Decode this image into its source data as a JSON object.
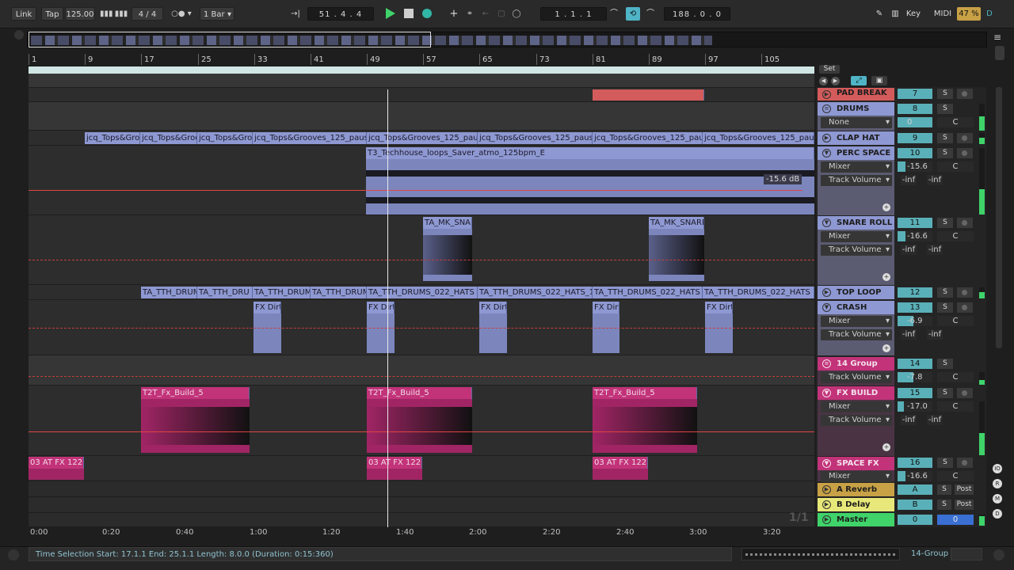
{
  "toolbar": {
    "link": "Link",
    "tap": "Tap",
    "tempo": "125.00",
    "signature": "4 / 4",
    "quantize": "1 Bar",
    "position": "51 . 4 . 4",
    "loop_start": "1 . 1 . 1",
    "loop_length": "188 . 0 . 0",
    "key": "Key",
    "midi": "MIDI",
    "cpu": "47 %",
    "disk": "D"
  },
  "ruler": {
    "bars": [
      "1",
      "9",
      "17",
      "25",
      "33",
      "41",
      "49",
      "57",
      "65",
      "73",
      "81",
      "89",
      "97",
      "105"
    ],
    "set_label": "Set"
  },
  "times": [
    "0:00",
    "0:20",
    "0:40",
    "1:00",
    "1:20",
    "1:40",
    "2:00",
    "2:20",
    "2:40",
    "3:00",
    "3:20"
  ],
  "page_counter": "1/1",
  "clips": {
    "tops": [
      "jcq_Tops&Groo",
      "jcq_Tops&Groo",
      "jcq_Tops&Groo",
      "jcq_Tops&Grooves_125_pause",
      "jcq_Tops&Grooves_125_paus",
      "jcq_Tops&Grooves_125_pause",
      "jcq_Tops&Grooves_125_pau",
      "jcq_Tops&Grooves_125_pause"
    ],
    "atmo": "T3_Techhouse_loops_Saver_atmo_125bpm_E",
    "atmo_gain": "-15.6 dB",
    "snare": [
      "TA_MK_SNAR",
      "TA_MK_SNARE"
    ],
    "hats": [
      "TA_TTH_DRUM",
      "TA_TTH_DRU",
      "TA_TTH_DRUM",
      "TA_TTH_DRUM",
      "TA_TTH_DRUMS_022_HATS",
      "TA_TTH_DRUMS_022_HATS_1",
      "TA_TTH_DRUMS_022_HATS",
      "TA_TTH_DRUMS_022_HATS"
    ],
    "fxdirt": [
      "FX Dirt",
      "FX Dirt",
      "FX Dirt",
      "FX Dirt",
      "FX Dirt"
    ],
    "fxbuild": [
      "T2T_Fx_Build_5",
      "T2T_Fx_Build_5",
      "T2T_Fx_Build_5"
    ],
    "spacefx": [
      "03 AT FX 122",
      "03 AT FX 122",
      "03 AT FX 122"
    ]
  },
  "tracks": [
    {
      "name": "PAD BREAK",
      "num": "7",
      "color": "#d45b5b"
    },
    {
      "name": "DRUMS",
      "num": "8",
      "color": "#8e98d2",
      "device": "None",
      "vol": "0",
      "pan": "C"
    },
    {
      "name": "CLAP HAT",
      "num": "9",
      "color": "#8e98d2"
    },
    {
      "name": "PERC SPACE",
      "num": "10",
      "color": "#8e98d2",
      "device": "Mixer",
      "param": "Track Volume",
      "vol": "-15.6",
      "pan": "C",
      "inl": "-inf",
      "inr": "-inf"
    },
    {
      "name": "SNARE ROLL",
      "num": "11",
      "color": "#8e98d2",
      "device": "Mixer",
      "param": "Track Volume",
      "vol": "-16.6",
      "pan": "C",
      "inl": "-inf",
      "inr": "-inf"
    },
    {
      "name": "TOP LOOP",
      "num": "12",
      "color": "#8e98d2"
    },
    {
      "name": "CRASH",
      "num": "13",
      "color": "#8e98d2",
      "device": "Mixer",
      "param": "Track Volume",
      "vol": "-6.9",
      "pan": "C",
      "inl": "-inf",
      "inr": "-inf"
    },
    {
      "name": "14 Group",
      "num": "14",
      "color": "#c23379",
      "param": "Track Volume",
      "vol": "-7.8",
      "pan": "C"
    },
    {
      "name": "FX BUILD",
      "num": "15",
      "color": "#c23379",
      "device": "Mixer",
      "param": "Track Volume",
      "vol": "-17.0",
      "pan": "C",
      "inl": "-inf",
      "inr": "-inf"
    },
    {
      "name": "SPACE FX",
      "num": "16",
      "color": "#c23379",
      "device": "Mixer",
      "vol": "-16.6",
      "pan": "C"
    },
    {
      "name": "A Reverb",
      "num": "A",
      "color": "#c8a146",
      "post": "Post"
    },
    {
      "name": "B Delay",
      "num": "B",
      "color": "#e8e87a",
      "post": "Post"
    },
    {
      "name": "Master",
      "num": "0",
      "color": "#3fd36a",
      "vol": "0"
    }
  ],
  "solo_label": "S",
  "status": {
    "text": "Time Selection   Start: 17.1.1   End: 25.1.1   Length: 8.0.0 (Duration: 0:15:360)",
    "track": "14-Group"
  }
}
